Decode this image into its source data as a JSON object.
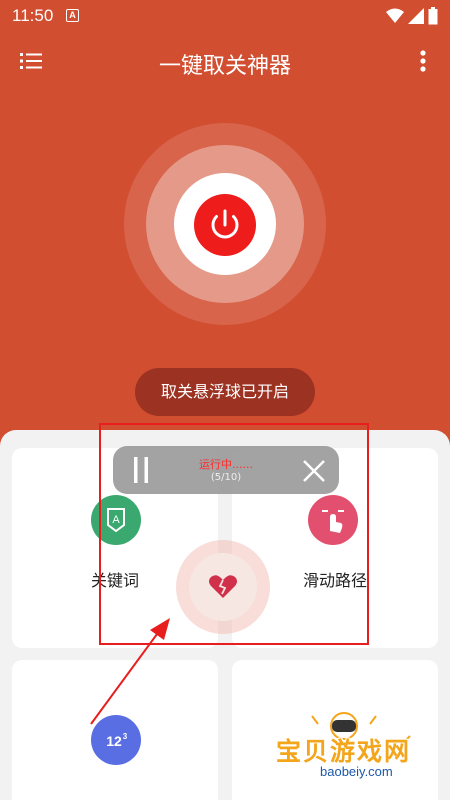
{
  "status_bar": {
    "time": "11:50",
    "notification_badge": "A"
  },
  "app_bar": {
    "title": "一键取关神器",
    "menu_icon": "list-menu-icon",
    "more_icon": "more-vert-icon"
  },
  "power": {
    "icon": "power-icon"
  },
  "status_pill": {
    "label": "取关悬浮球已开启"
  },
  "features": [
    {
      "label": "关键词",
      "icon": "keyword-icon",
      "color": "#3aa86f"
    },
    {
      "label": "滑动路径",
      "icon": "swipe-path-icon",
      "color": "#e3506f"
    },
    {
      "label": "",
      "icon": "count-123-icon",
      "color": "#5a6ee3"
    }
  ],
  "floating_bar": {
    "status": "运行中......",
    "progress": "(5/10)"
  },
  "watermark": {
    "text": "宝贝游戏网",
    "domain": "baobeiy.com"
  },
  "colors": {
    "brand": "#d24e31",
    "power": "#ef1c1c",
    "highlight": "#e81e1e"
  }
}
